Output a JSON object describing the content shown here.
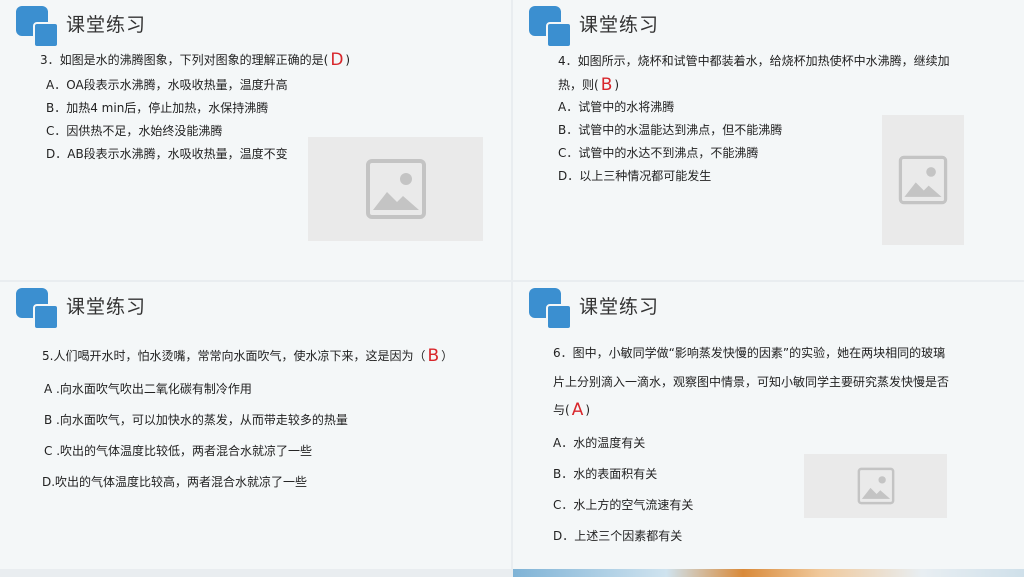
{
  "slides": [
    {
      "heading": "课堂练习",
      "question": "3．如图是水的沸腾图象，下列对图象的理解正确的是(",
      "answer": "D",
      "close": ")",
      "options": [
        "A．OA段表示水沸腾，水吸收热量，温度升高",
        "B．加热4 min后，停止加热，水保持沸腾",
        "C．因供热不足，水始终没能沸腾",
        "D．AB段表示水沸腾，水吸收热量，温度不变"
      ]
    },
    {
      "heading": "课堂练习",
      "question_line1": "4．如图所示，烧杯和试管中都装着水，给烧杯加热使杯中水沸腾，继续加",
      "question_line2": "热，则(",
      "answer": "B",
      "close": ")",
      "options": [
        "A．试管中的水将沸腾",
        "B．试管中的水温能达到沸点，但不能沸腾",
        "C．试管中的水达不到沸点，不能沸腾",
        "D．以上三种情况都可能发生"
      ]
    },
    {
      "heading": "课堂练习",
      "question": "5.人们喝开水时，怕水烫嘴，常常向水面吹气，使水凉下来，这是因为（",
      "answer": "B",
      "close": "）",
      "options": [
        "A .向水面吹气吹出二氧化碳有制冷作用",
        "B .向水面吹气，可以加快水的蒸发，从而带走较多的热量",
        "C .吹出的气体温度比较低，两者混合水就凉了一些",
        "D.吹出的气体温度比较高，两者混合水就凉了一些"
      ]
    },
    {
      "heading": "课堂练习",
      "question_line1": "6．图中，小敏同学做“影响蒸发快慢的因素”的实验，她在两块相同的玻璃",
      "question_line2": "片上分别滴入一滴水，观察图中情景，可知小敏同学主要研究蒸发快慢是否",
      "question_line3": "与(",
      "answer": "A",
      "close": ")",
      "options": [
        "A．水的温度有关",
        "B．水的表面积有关",
        "C．水上方的空气流速有关",
        "D．上述三个因素都有关"
      ]
    }
  ],
  "icons": {
    "logo": "blue-squares-logo-icon",
    "placeholder": "image-placeholder-icon"
  },
  "colors": {
    "accent": "#3b8fd0",
    "answer": "#d8262b",
    "background": "#f4f7f8"
  }
}
